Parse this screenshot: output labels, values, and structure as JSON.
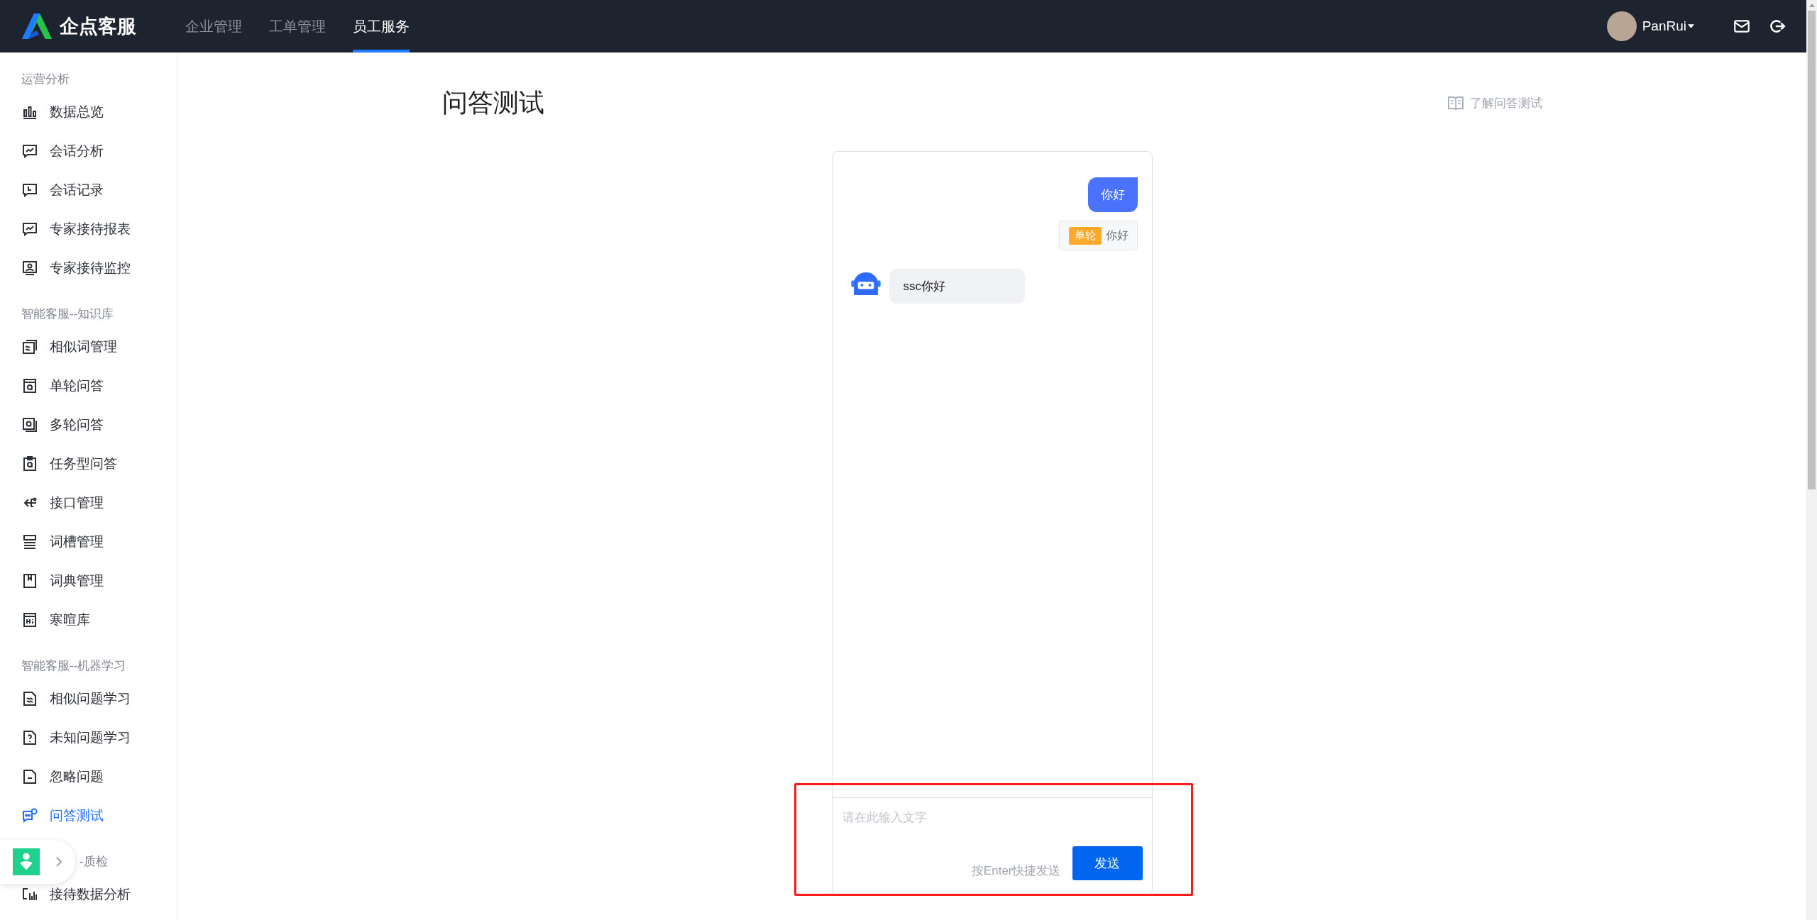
{
  "topbar": {
    "brand": "企点客服",
    "nav": [
      {
        "label": "企业管理",
        "selected": false
      },
      {
        "label": "工单管理",
        "selected": false
      },
      {
        "label": "员工服务",
        "selected": true
      }
    ],
    "user": {
      "name": "PanRui"
    }
  },
  "sidebar": {
    "groups": [
      {
        "heading": "运营分析",
        "items": [
          {
            "label": "数据总览",
            "selected": false
          },
          {
            "label": "会话分析",
            "selected": false
          },
          {
            "label": "会话记录",
            "selected": false
          },
          {
            "label": "专家接待报表",
            "selected": false
          },
          {
            "label": "专家接待监控",
            "selected": false
          }
        ]
      },
      {
        "heading": "智能客服--知识库",
        "items": [
          {
            "label": "相似词管理",
            "selected": false
          },
          {
            "label": "单轮问答",
            "selected": false
          },
          {
            "label": "多轮问答",
            "selected": false
          },
          {
            "label": "任务型问答",
            "selected": false
          },
          {
            "label": "接口管理",
            "selected": false
          },
          {
            "label": "词槽管理",
            "selected": false
          },
          {
            "label": "词典管理",
            "selected": false
          },
          {
            "label": "寒暄库",
            "selected": false
          }
        ]
      },
      {
        "heading": "智能客服--机器学习",
        "items": [
          {
            "label": "相似问题学习",
            "selected": false
          },
          {
            "label": "未知问题学习",
            "selected": false
          },
          {
            "label": "忽略问题",
            "selected": false
          },
          {
            "label": "问答测试",
            "selected": true
          }
        ]
      },
      {
        "heading": "-质检",
        "items": [
          {
            "label": "接待数据分析",
            "selected": false
          }
        ]
      }
    ]
  },
  "page": {
    "title": "问答测试",
    "help_link": "了解问答测试"
  },
  "chat": {
    "messages": [
      {
        "kind": "user",
        "text": "你好"
      },
      {
        "kind": "match",
        "tag": "单轮",
        "text": "你好"
      },
      {
        "kind": "bot",
        "text": "ssc你好"
      }
    ],
    "input": {
      "placeholder": "请在此输入文字"
    },
    "hint": "按Enter快捷发送",
    "send_button": "发送"
  }
}
